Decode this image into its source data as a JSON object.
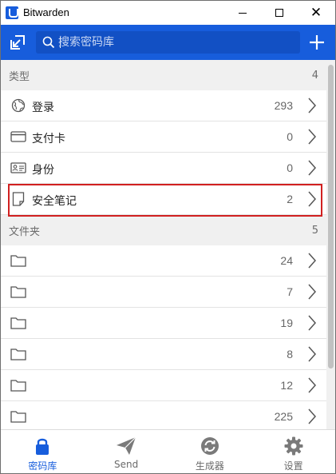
{
  "window": {
    "title": "Bitwarden"
  },
  "header": {
    "search_placeholder": "搜索密码库"
  },
  "types": {
    "title": "类型",
    "count": "4",
    "items": [
      {
        "label": "登录",
        "count": "293",
        "icon": "globe-icon"
      },
      {
        "label": "支付卡",
        "count": "0",
        "icon": "credit-card-icon"
      },
      {
        "label": "身份",
        "count": "0",
        "icon": "id-card-icon"
      },
      {
        "label": "安全笔记",
        "count": "2",
        "icon": "note-icon",
        "selected": true
      }
    ]
  },
  "folders": {
    "title": "文件夹",
    "count": "5",
    "items": [
      {
        "label": "",
        "count": "24",
        "icon": "folder-icon"
      },
      {
        "label": "",
        "count": "7",
        "icon": "folder-icon"
      },
      {
        "label": "",
        "count": "19",
        "icon": "folder-icon"
      },
      {
        "label": "",
        "count": "8",
        "icon": "folder-icon"
      },
      {
        "label": "",
        "count": "12",
        "icon": "folder-icon"
      },
      {
        "label": "",
        "count": "225",
        "icon": "folder-icon"
      }
    ]
  },
  "tabs": [
    {
      "label": "密码库",
      "icon": "lock-icon",
      "active": true
    },
    {
      "label": "Send",
      "icon": "send-icon",
      "active": false
    },
    {
      "label": "生成器",
      "icon": "generator-icon",
      "active": false
    },
    {
      "label": "设置",
      "icon": "gear-icon",
      "active": false
    }
  ],
  "colors": {
    "brand": "#175ddc",
    "highlight": "#d12020"
  }
}
